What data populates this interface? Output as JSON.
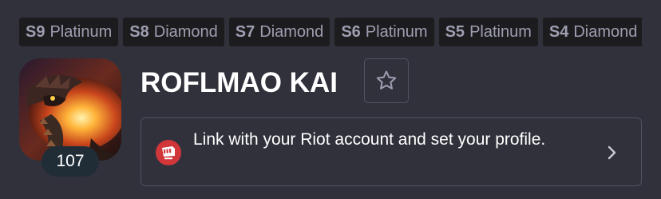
{
  "tiers": [
    {
      "season": "S9",
      "rank": "Platinum"
    },
    {
      "season": "S8",
      "rank": "Diamond"
    },
    {
      "season": "S7",
      "rank": "Diamond"
    },
    {
      "season": "S6",
      "rank": "Platinum"
    },
    {
      "season": "S5",
      "rank": "Platinum"
    },
    {
      "season": "S4",
      "rank": "Diamond"
    }
  ],
  "profile": {
    "level": "107",
    "icon": "dragon-profile-icon"
  },
  "summoner": {
    "name": "ROFLMAO KAI"
  },
  "favorite": {
    "icon": "star-outline-icon"
  },
  "riot_link": {
    "text": "Link with your Riot account and set your profile.",
    "logo_icon": "riot-fist-icon",
    "arrow_icon": "chevron-right-icon"
  },
  "colors": {
    "background": "#31313c",
    "badge_background": "#1c1c1f",
    "badge_text": "#9e9eb1",
    "border": "#515163",
    "riot_red": "#d13639",
    "level_badge": "#202d37"
  }
}
